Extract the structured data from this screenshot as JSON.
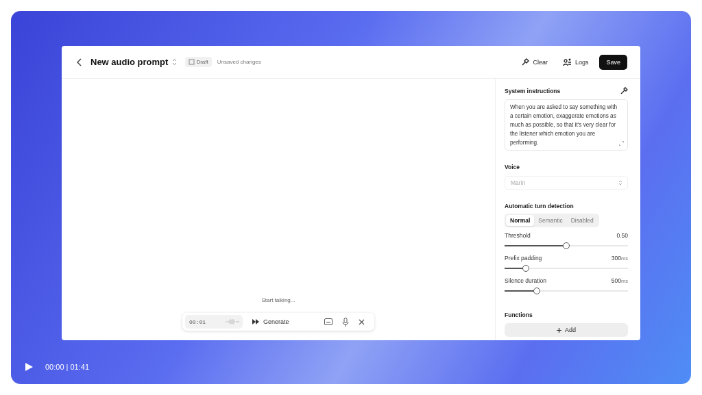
{
  "player": {
    "time": "00:00 | 01:41",
    "playing": false
  },
  "app": {
    "title": "New audio prompt",
    "badge": "Draft",
    "status": "Unsaved changes",
    "actions": [
      {
        "label": "Clear",
        "kind": "clear"
      },
      {
        "label": "Logs",
        "kind": "logs"
      }
    ],
    "save": "Save",
    "hint": "Start talking...",
    "recorder": {
      "time": "00:01",
      "generate": "Generate"
    },
    "panel": {
      "system": {
        "label": "System instructions",
        "text": "When you are asked to say something with a certain emotion, exaggerate emotions as much as possible, so that it's very clear for the listener which emotion you are performing."
      },
      "voice": {
        "label": "Voice",
        "placeholder": "Marin"
      },
      "turn": {
        "label": "Automatic turn detection",
        "modes": [
          {
            "label": "Normal",
            "selected": true
          },
          {
            "label": "Semantic",
            "selected": false
          },
          {
            "label": "Disabled",
            "selected": false
          }
        ]
      },
      "sliders": [
        {
          "name": "Threshold",
          "value": "0.50",
          "level": 0.5
        },
        {
          "name": "Prefix padding",
          "value": "300",
          "unit": "ms",
          "level": 0.17
        },
        {
          "name": "Silence duration",
          "value": "500",
          "unit": "ms",
          "level": 0.26
        }
      ],
      "functions": {
        "label": "Functions",
        "add": "Add"
      }
    }
  }
}
